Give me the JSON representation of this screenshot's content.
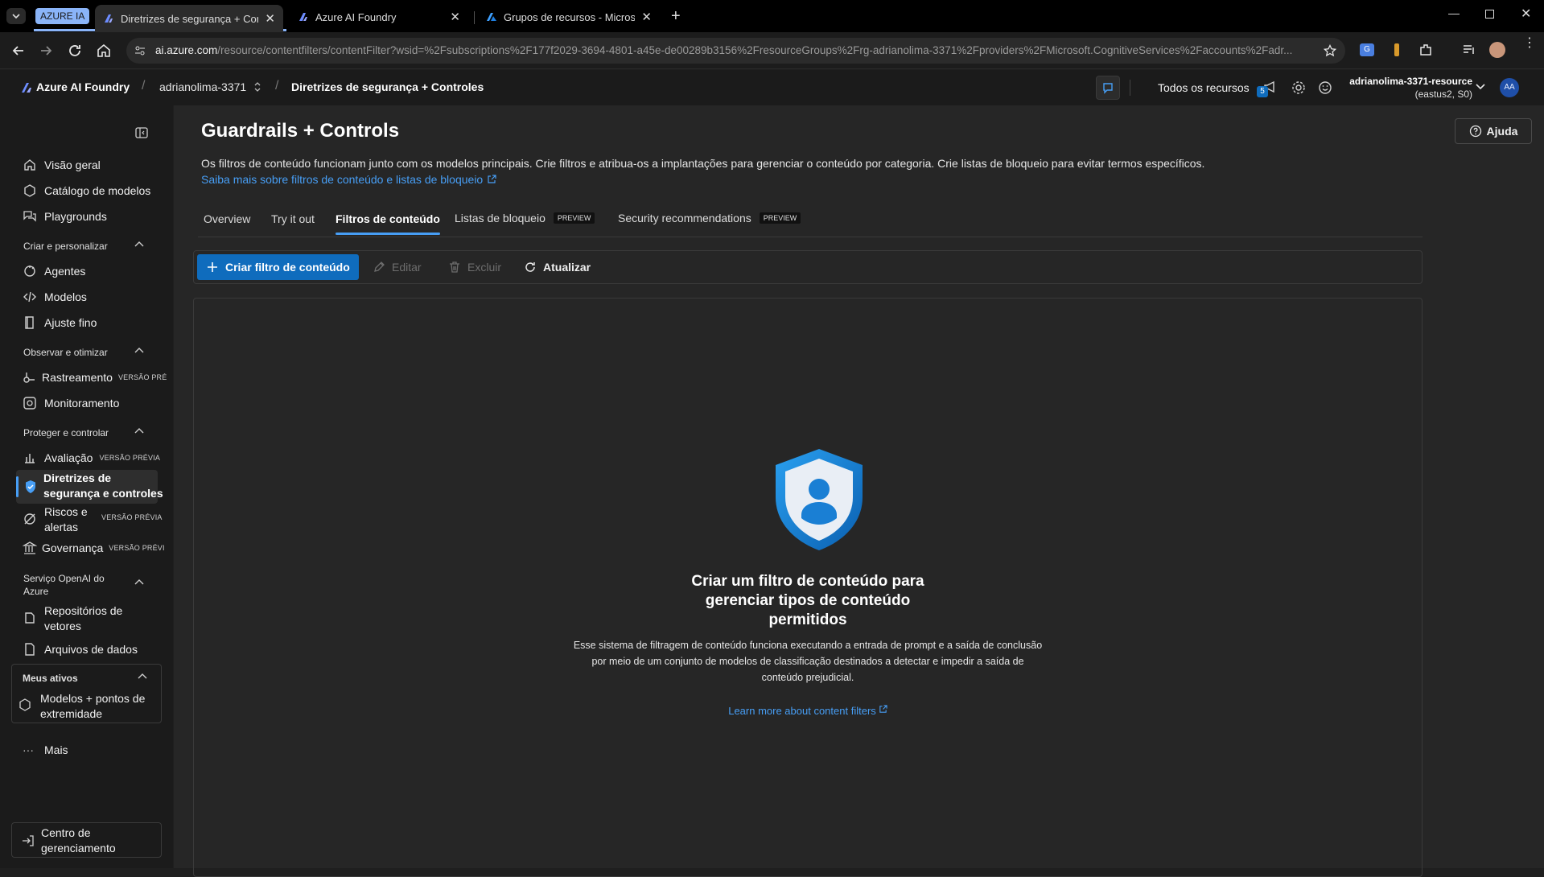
{
  "browser": {
    "group_label": "AZURE IA",
    "tabs": [
      {
        "label": "Diretrizes de segurança + Cont",
        "active": true
      },
      {
        "label": "Azure AI Foundry",
        "active": false
      },
      {
        "label": "Grupos de recursos - Microsoft",
        "active": false
      }
    ],
    "url_host": "ai.azure.com",
    "url_path": "/resource/contentfilters/contentFilter?wsid=%2Fsubscriptions%2F177f2029-3694-4801-a45e-de00289b3156%2FresourceGroups%2Frg-adrianolima-3371%2Fproviders%2FMicrosoft.CognitiveServices%2Faccounts%2Fadr..."
  },
  "header": {
    "brand": "Azure AI Foundry",
    "project": "adrianolima-3371",
    "page": "Diretrizes de segurança + Controles",
    "all_resources": "Todos os recursos",
    "notif_count": "5",
    "resource_name": "adrianolima-3371-resource",
    "resource_region": "(eastus2, S0)",
    "avatar": "AA"
  },
  "sidebar": {
    "top_items": [
      "Visão geral",
      "Catálogo de modelos",
      "Playgrounds"
    ],
    "section_create": "Criar e personalizar",
    "create_items": [
      "Agentes",
      "Modelos",
      "Ajuste fino"
    ],
    "section_observe": "Observar e otimizar",
    "observe_items": [
      {
        "label": "Rastreamento",
        "badge": "VERSÃO PRÉ"
      },
      {
        "label": "Monitoramento",
        "badge": ""
      }
    ],
    "section_protect": "Proteger e controlar",
    "protect_items": [
      {
        "label": "Avaliação",
        "badge": "VERSÃO PRÉVIA"
      },
      {
        "label_l1": "Diretrizes de",
        "label_l2": "segurança e controles",
        "badge": ""
      },
      {
        "label_l1": "Riscos e",
        "label_l2": "alertas",
        "badge": "VERSÃO PRÉVIA"
      },
      {
        "label": "Governança",
        "badge": "VERSÃO PRÉVI"
      }
    ],
    "section_openai_l1": "Serviço OpenAI do",
    "section_openai_l2": "Azure",
    "openai_items": [
      {
        "label_l1": "Repositórios de",
        "label_l2": "vetores"
      },
      {
        "label": "Arquivos de dados"
      }
    ],
    "section_assets": "Meus ativos",
    "asset_item_l1": "Modelos + pontos de",
    "asset_item_l2": "extremidade",
    "more": "Mais",
    "mgmt_l1": "Centro de",
    "mgmt_l2": "gerenciamento"
  },
  "main": {
    "title": "Guardrails + Controls",
    "help": "Ajuda",
    "description": "Os filtros de conteúdo funcionam junto com os modelos principais. Crie filtros e atribua-os a implantações para gerenciar o conteúdo por categoria. Crie listas de bloqueio para evitar termos específicos.",
    "learn_link": "Saiba mais sobre filtros de conteúdo e listas de bloqueio",
    "tabs": [
      {
        "label": "Overview",
        "badge": ""
      },
      {
        "label": "Try it out",
        "badge": ""
      },
      {
        "label": "Filtros de conteúdo",
        "badge": ""
      },
      {
        "label": "Listas de bloqueio",
        "badge": "PREVIEW"
      },
      {
        "label": "Security recommendations",
        "badge": "PREVIEW"
      }
    ],
    "toolbar": {
      "create": "Criar filtro de conteúdo",
      "edit": "Editar",
      "delete": "Excluir",
      "refresh": "Atualizar"
    },
    "empty": {
      "title_l1": "Criar um filtro de conteúdo para",
      "title_l2": "gerenciar tipos de conteúdo",
      "title_l3": "permitidos",
      "body_l1": "Esse sistema de filtragem de conteúdo funciona executando a entrada de prompt e a saída de conclusão",
      "body_l2": "por meio de um conjunto de modelos de classificação destinados a detectar e impedir a saída de",
      "body_l3": "conteúdo prejudicial.",
      "link": "Learn more about content filters"
    }
  },
  "colors": {
    "accent": "#0f6cbd",
    "link": "#479ef5",
    "selected_tab_underline": "#479ef5"
  }
}
